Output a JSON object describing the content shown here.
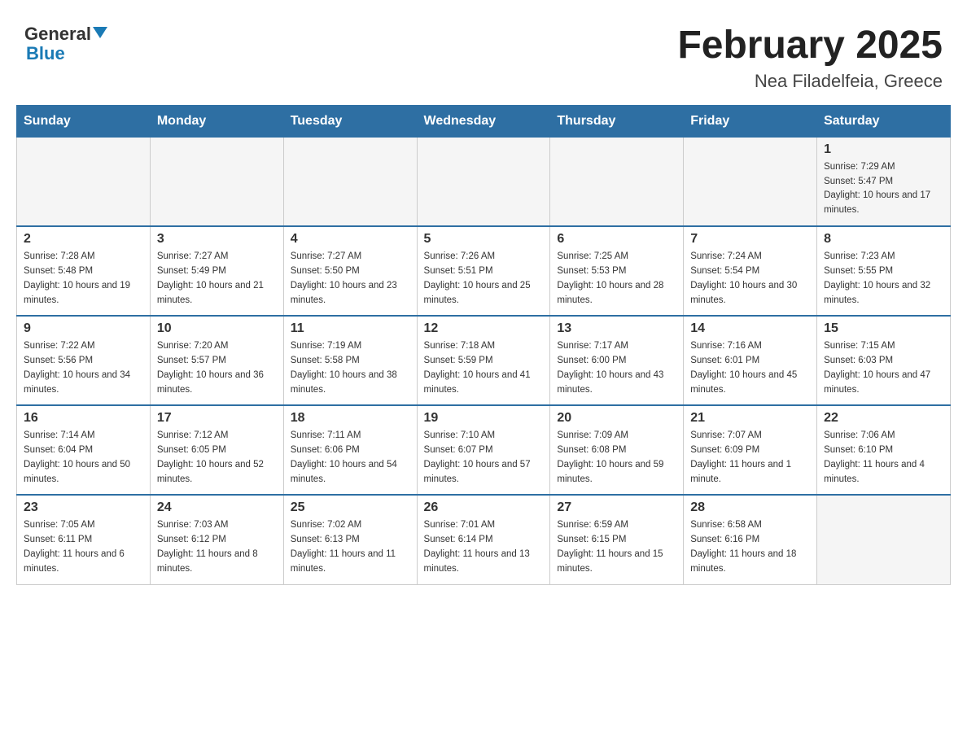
{
  "header": {
    "logo_general": "General",
    "logo_blue": "Blue",
    "month_title": "February 2025",
    "location": "Nea Filadelfeia, Greece"
  },
  "weekdays": [
    "Sunday",
    "Monday",
    "Tuesday",
    "Wednesday",
    "Thursday",
    "Friday",
    "Saturday"
  ],
  "weeks": [
    [
      {
        "day": "",
        "sunrise": "",
        "sunset": "",
        "daylight": ""
      },
      {
        "day": "",
        "sunrise": "",
        "sunset": "",
        "daylight": ""
      },
      {
        "day": "",
        "sunrise": "",
        "sunset": "",
        "daylight": ""
      },
      {
        "day": "",
        "sunrise": "",
        "sunset": "",
        "daylight": ""
      },
      {
        "day": "",
        "sunrise": "",
        "sunset": "",
        "daylight": ""
      },
      {
        "day": "",
        "sunrise": "",
        "sunset": "",
        "daylight": ""
      },
      {
        "day": "1",
        "sunrise": "Sunrise: 7:29 AM",
        "sunset": "Sunset: 5:47 PM",
        "daylight": "Daylight: 10 hours and 17 minutes."
      }
    ],
    [
      {
        "day": "2",
        "sunrise": "Sunrise: 7:28 AM",
        "sunset": "Sunset: 5:48 PM",
        "daylight": "Daylight: 10 hours and 19 minutes."
      },
      {
        "day": "3",
        "sunrise": "Sunrise: 7:27 AM",
        "sunset": "Sunset: 5:49 PM",
        "daylight": "Daylight: 10 hours and 21 minutes."
      },
      {
        "day": "4",
        "sunrise": "Sunrise: 7:27 AM",
        "sunset": "Sunset: 5:50 PM",
        "daylight": "Daylight: 10 hours and 23 minutes."
      },
      {
        "day": "5",
        "sunrise": "Sunrise: 7:26 AM",
        "sunset": "Sunset: 5:51 PM",
        "daylight": "Daylight: 10 hours and 25 minutes."
      },
      {
        "day": "6",
        "sunrise": "Sunrise: 7:25 AM",
        "sunset": "Sunset: 5:53 PM",
        "daylight": "Daylight: 10 hours and 28 minutes."
      },
      {
        "day": "7",
        "sunrise": "Sunrise: 7:24 AM",
        "sunset": "Sunset: 5:54 PM",
        "daylight": "Daylight: 10 hours and 30 minutes."
      },
      {
        "day": "8",
        "sunrise": "Sunrise: 7:23 AM",
        "sunset": "Sunset: 5:55 PM",
        "daylight": "Daylight: 10 hours and 32 minutes."
      }
    ],
    [
      {
        "day": "9",
        "sunrise": "Sunrise: 7:22 AM",
        "sunset": "Sunset: 5:56 PM",
        "daylight": "Daylight: 10 hours and 34 minutes."
      },
      {
        "day": "10",
        "sunrise": "Sunrise: 7:20 AM",
        "sunset": "Sunset: 5:57 PM",
        "daylight": "Daylight: 10 hours and 36 minutes."
      },
      {
        "day": "11",
        "sunrise": "Sunrise: 7:19 AM",
        "sunset": "Sunset: 5:58 PM",
        "daylight": "Daylight: 10 hours and 38 minutes."
      },
      {
        "day": "12",
        "sunrise": "Sunrise: 7:18 AM",
        "sunset": "Sunset: 5:59 PM",
        "daylight": "Daylight: 10 hours and 41 minutes."
      },
      {
        "day": "13",
        "sunrise": "Sunrise: 7:17 AM",
        "sunset": "Sunset: 6:00 PM",
        "daylight": "Daylight: 10 hours and 43 minutes."
      },
      {
        "day": "14",
        "sunrise": "Sunrise: 7:16 AM",
        "sunset": "Sunset: 6:01 PM",
        "daylight": "Daylight: 10 hours and 45 minutes."
      },
      {
        "day": "15",
        "sunrise": "Sunrise: 7:15 AM",
        "sunset": "Sunset: 6:03 PM",
        "daylight": "Daylight: 10 hours and 47 minutes."
      }
    ],
    [
      {
        "day": "16",
        "sunrise": "Sunrise: 7:14 AM",
        "sunset": "Sunset: 6:04 PM",
        "daylight": "Daylight: 10 hours and 50 minutes."
      },
      {
        "day": "17",
        "sunrise": "Sunrise: 7:12 AM",
        "sunset": "Sunset: 6:05 PM",
        "daylight": "Daylight: 10 hours and 52 minutes."
      },
      {
        "day": "18",
        "sunrise": "Sunrise: 7:11 AM",
        "sunset": "Sunset: 6:06 PM",
        "daylight": "Daylight: 10 hours and 54 minutes."
      },
      {
        "day": "19",
        "sunrise": "Sunrise: 7:10 AM",
        "sunset": "Sunset: 6:07 PM",
        "daylight": "Daylight: 10 hours and 57 minutes."
      },
      {
        "day": "20",
        "sunrise": "Sunrise: 7:09 AM",
        "sunset": "Sunset: 6:08 PM",
        "daylight": "Daylight: 10 hours and 59 minutes."
      },
      {
        "day": "21",
        "sunrise": "Sunrise: 7:07 AM",
        "sunset": "Sunset: 6:09 PM",
        "daylight": "Daylight: 11 hours and 1 minute."
      },
      {
        "day": "22",
        "sunrise": "Sunrise: 7:06 AM",
        "sunset": "Sunset: 6:10 PM",
        "daylight": "Daylight: 11 hours and 4 minutes."
      }
    ],
    [
      {
        "day": "23",
        "sunrise": "Sunrise: 7:05 AM",
        "sunset": "Sunset: 6:11 PM",
        "daylight": "Daylight: 11 hours and 6 minutes."
      },
      {
        "day": "24",
        "sunrise": "Sunrise: 7:03 AM",
        "sunset": "Sunset: 6:12 PM",
        "daylight": "Daylight: 11 hours and 8 minutes."
      },
      {
        "day": "25",
        "sunrise": "Sunrise: 7:02 AM",
        "sunset": "Sunset: 6:13 PM",
        "daylight": "Daylight: 11 hours and 11 minutes."
      },
      {
        "day": "26",
        "sunrise": "Sunrise: 7:01 AM",
        "sunset": "Sunset: 6:14 PM",
        "daylight": "Daylight: 11 hours and 13 minutes."
      },
      {
        "day": "27",
        "sunrise": "Sunrise: 6:59 AM",
        "sunset": "Sunset: 6:15 PM",
        "daylight": "Daylight: 11 hours and 15 minutes."
      },
      {
        "day": "28",
        "sunrise": "Sunrise: 6:58 AM",
        "sunset": "Sunset: 6:16 PM",
        "daylight": "Daylight: 11 hours and 18 minutes."
      },
      {
        "day": "",
        "sunrise": "",
        "sunset": "",
        "daylight": ""
      }
    ]
  ]
}
